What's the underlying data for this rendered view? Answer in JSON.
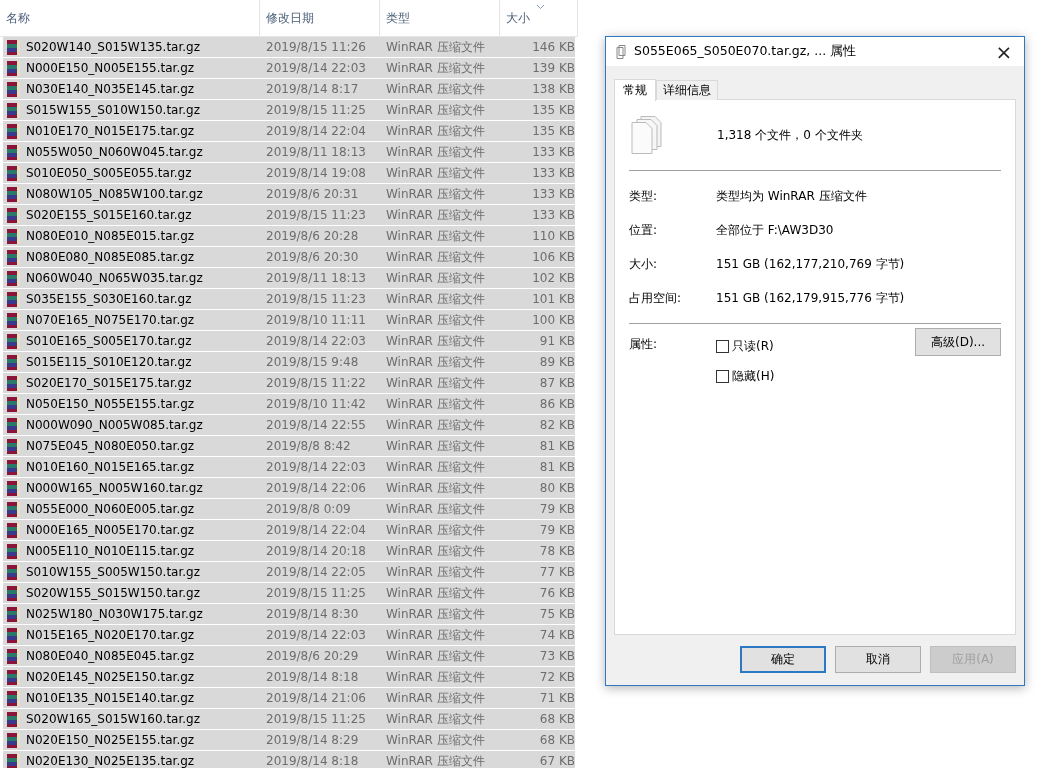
{
  "file_list": {
    "columns": [
      {
        "label": "名称",
        "sorted": false
      },
      {
        "label": "修改日期",
        "sorted": false
      },
      {
        "label": "类型",
        "sorted": false
      },
      {
        "label": "大小",
        "sorted": true
      }
    ],
    "rows": [
      {
        "name": "S020W140_S015W135.tar.gz",
        "modified": "2019/8/15 11:26",
        "type": "WinRAR 压缩文件",
        "size": "146 KB",
        "selected": true
      },
      {
        "name": "N000E150_N005E155.tar.gz",
        "modified": "2019/8/14 22:03",
        "type": "WinRAR 压缩文件",
        "size": "139 KB",
        "selected": true
      },
      {
        "name": "N030E140_N035E145.tar.gz",
        "modified": "2019/8/14 8:17",
        "type": "WinRAR 压缩文件",
        "size": "138 KB",
        "selected": true
      },
      {
        "name": "S015W155_S010W150.tar.gz",
        "modified": "2019/8/15 11:25",
        "type": "WinRAR 压缩文件",
        "size": "135 KB",
        "selected": true
      },
      {
        "name": "N010E170_N015E175.tar.gz",
        "modified": "2019/8/14 22:04",
        "type": "WinRAR 压缩文件",
        "size": "135 KB",
        "selected": true
      },
      {
        "name": "N055W050_N060W045.tar.gz",
        "modified": "2019/8/11 18:13",
        "type": "WinRAR 压缩文件",
        "size": "133 KB",
        "selected": true
      },
      {
        "name": "S010E050_S005E055.tar.gz",
        "modified": "2019/8/14 19:08",
        "type": "WinRAR 压缩文件",
        "size": "133 KB",
        "selected": true
      },
      {
        "name": "N080W105_N085W100.tar.gz",
        "modified": "2019/8/6 20:31",
        "type": "WinRAR 压缩文件",
        "size": "133 KB",
        "selected": true
      },
      {
        "name": "S020E155_S015E160.tar.gz",
        "modified": "2019/8/15 11:23",
        "type": "WinRAR 压缩文件",
        "size": "133 KB",
        "selected": true
      },
      {
        "name": "N080E010_N085E015.tar.gz",
        "modified": "2019/8/6 20:28",
        "type": "WinRAR 压缩文件",
        "size": "110 KB",
        "selected": true
      },
      {
        "name": "N080E080_N085E085.tar.gz",
        "modified": "2019/8/6 20:30",
        "type": "WinRAR 压缩文件",
        "size": "106 KB",
        "selected": true
      },
      {
        "name": "N060W040_N065W035.tar.gz",
        "modified": "2019/8/11 18:13",
        "type": "WinRAR 压缩文件",
        "size": "102 KB",
        "selected": true
      },
      {
        "name": "S035E155_S030E160.tar.gz",
        "modified": "2019/8/15 11:23",
        "type": "WinRAR 压缩文件",
        "size": "101 KB",
        "selected": true
      },
      {
        "name": "N070E165_N075E170.tar.gz",
        "modified": "2019/8/10 11:11",
        "type": "WinRAR 压缩文件",
        "size": "100 KB",
        "selected": true
      },
      {
        "name": "S010E165_S005E170.tar.gz",
        "modified": "2019/8/14 22:03",
        "type": "WinRAR 压缩文件",
        "size": "91 KB",
        "selected": true
      },
      {
        "name": "S015E115_S010E120.tar.gz",
        "modified": "2019/8/15 9:48",
        "type": "WinRAR 压缩文件",
        "size": "89 KB",
        "selected": true
      },
      {
        "name": "S020E170_S015E175.tar.gz",
        "modified": "2019/8/15 11:22",
        "type": "WinRAR 压缩文件",
        "size": "87 KB",
        "selected": true
      },
      {
        "name": "N050E150_N055E155.tar.gz",
        "modified": "2019/8/10 11:42",
        "type": "WinRAR 压缩文件",
        "size": "86 KB",
        "selected": true
      },
      {
        "name": "N000W090_N005W085.tar.gz",
        "modified": "2019/8/14 22:55",
        "type": "WinRAR 压缩文件",
        "size": "82 KB",
        "selected": true
      },
      {
        "name": "N075E045_N080E050.tar.gz",
        "modified": "2019/8/8 8:42",
        "type": "WinRAR 压缩文件",
        "size": "81 KB",
        "selected": true
      },
      {
        "name": "N010E160_N015E165.tar.gz",
        "modified": "2019/8/14 22:03",
        "type": "WinRAR 压缩文件",
        "size": "81 KB",
        "selected": true
      },
      {
        "name": "N000W165_N005W160.tar.gz",
        "modified": "2019/8/14 22:06",
        "type": "WinRAR 压缩文件",
        "size": "80 KB",
        "selected": true
      },
      {
        "name": "N055E000_N060E005.tar.gz",
        "modified": "2019/8/8 0:09",
        "type": "WinRAR 压缩文件",
        "size": "79 KB",
        "selected": true
      },
      {
        "name": "N000E165_N005E170.tar.gz",
        "modified": "2019/8/14 22:04",
        "type": "WinRAR 压缩文件",
        "size": "79 KB",
        "selected": true
      },
      {
        "name": "N005E110_N010E115.tar.gz",
        "modified": "2019/8/14 20:18",
        "type": "WinRAR 压缩文件",
        "size": "78 KB",
        "selected": true
      },
      {
        "name": "S010W155_S005W150.tar.gz",
        "modified": "2019/8/14 22:05",
        "type": "WinRAR 压缩文件",
        "size": "77 KB",
        "selected": true
      },
      {
        "name": "S020W155_S015W150.tar.gz",
        "modified": "2019/8/15 11:25",
        "type": "WinRAR 压缩文件",
        "size": "76 KB",
        "selected": true
      },
      {
        "name": "N025W180_N030W175.tar.gz",
        "modified": "2019/8/14 8:30",
        "type": "WinRAR 压缩文件",
        "size": "75 KB",
        "selected": true
      },
      {
        "name": "N015E165_N020E170.tar.gz",
        "modified": "2019/8/14 22:03",
        "type": "WinRAR 压缩文件",
        "size": "74 KB",
        "selected": true
      },
      {
        "name": "N080E040_N085E045.tar.gz",
        "modified": "2019/8/6 20:29",
        "type": "WinRAR 压缩文件",
        "size": "73 KB",
        "selected": true
      },
      {
        "name": "N020E145_N025E150.tar.gz",
        "modified": "2019/8/14 8:18",
        "type": "WinRAR 压缩文件",
        "size": "72 KB",
        "selected": true
      },
      {
        "name": "N010E135_N015E140.tar.gz",
        "modified": "2019/8/14 21:06",
        "type": "WinRAR 压缩文件",
        "size": "71 KB",
        "selected": true
      },
      {
        "name": "S020W165_S015W160.tar.gz",
        "modified": "2019/8/15 11:25",
        "type": "WinRAR 压缩文件",
        "size": "68 KB",
        "selected": true
      },
      {
        "name": "N020E150_N025E155.tar.gz",
        "modified": "2019/8/14 8:29",
        "type": "WinRAR 压缩文件",
        "size": "68 KB",
        "selected": true
      },
      {
        "name": "N020E130_N025E135.tar.gz",
        "modified": "2019/8/14 8:18",
        "type": "WinRAR 压缩文件",
        "size": "67 KB",
        "selected": true
      }
    ]
  },
  "dialog": {
    "title": "S055E065_S050E070.tar.gz, ... 属性",
    "close": "×",
    "tabs": [
      {
        "label": "常规",
        "selected": true
      },
      {
        "label": "详细信息",
        "selected": false
      }
    ],
    "summary": "1,318 个文件，0 个文件夹",
    "properties": [
      {
        "label": "类型:",
        "value": "类型均为 WinRAR 压缩文件"
      },
      {
        "label": "位置:",
        "value": "全部位于 F:\\AW3D30"
      },
      {
        "label": "大小:",
        "value": "151 GB (162,177,210,769 字节)"
      },
      {
        "label": "占用空间:",
        "value": "151 GB (162,179,915,776 字节)"
      }
    ],
    "attributes_label": "属性:",
    "attributes": [
      {
        "label": "只读(R)",
        "checked": false
      },
      {
        "label": "隐藏(H)",
        "checked": false
      }
    ],
    "advanced_button": "高级(D)...",
    "buttons": [
      {
        "label": "确定",
        "default": true,
        "disabled": false
      },
      {
        "label": "取消",
        "default": false,
        "disabled": false
      },
      {
        "label": "应用(A)",
        "default": false,
        "disabled": true
      }
    ]
  }
}
